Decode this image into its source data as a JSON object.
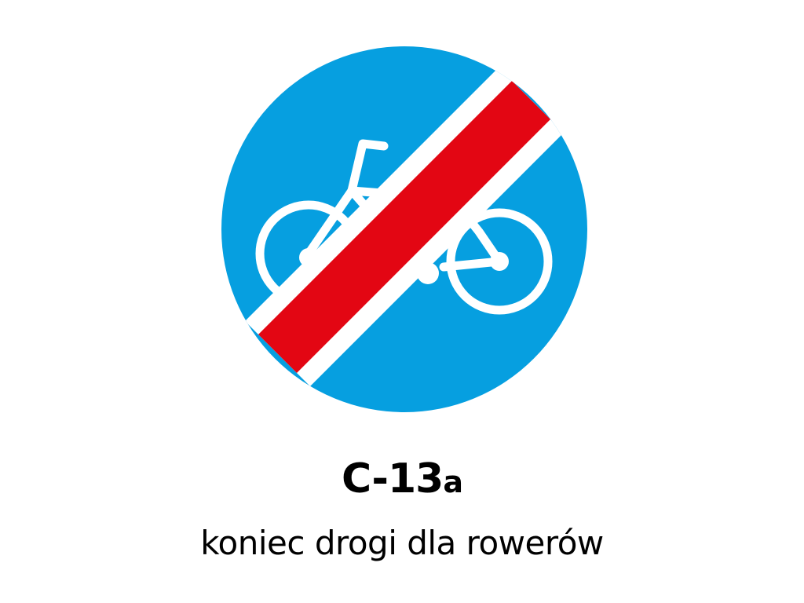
{
  "sign": {
    "code_main": "C-13",
    "code_suffix": "a",
    "caption": "koniec drogi dla rowerów",
    "icon": "bicycle-icon",
    "colors": {
      "disc": "#069fe0",
      "bar": "#e30613",
      "symbol": "#ffffff",
      "text": "#000000"
    }
  }
}
